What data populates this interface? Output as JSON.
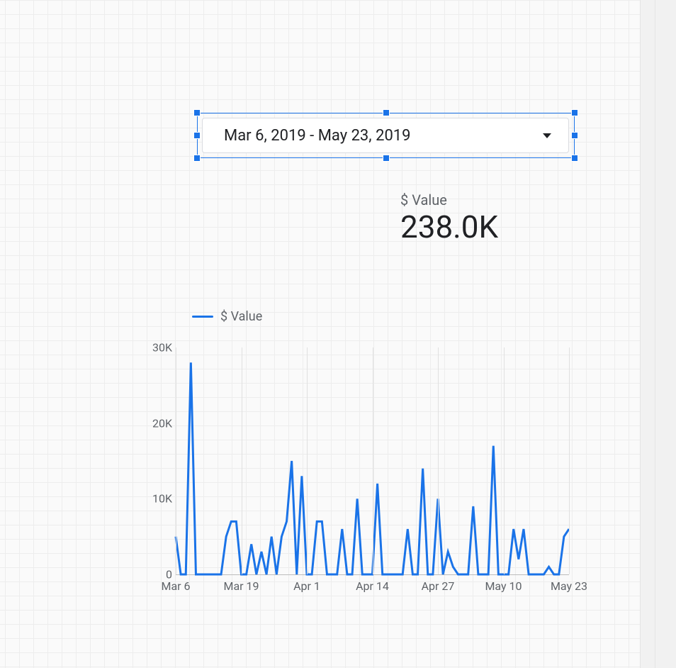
{
  "date_range": {
    "label": "Mar 6, 2019 - May 23, 2019"
  },
  "kpi": {
    "label": "$ Value",
    "value": "238.0K"
  },
  "legend": {
    "series_label": "$ Value"
  },
  "y_ticks": [
    "0",
    "10K",
    "20K",
    "30K"
  ],
  "x_ticks": [
    "Mar 6",
    "Mar 19",
    "Apr 1",
    "Apr 14",
    "Apr 27",
    "May 10",
    "May 23"
  ],
  "colors": {
    "series": "#1a73e8",
    "text_muted": "#5f6368",
    "text": "#202124"
  },
  "chart_data": {
    "type": "line",
    "title": "",
    "xlabel": "",
    "ylabel": "",
    "ylim": [
      0,
      30000
    ],
    "series": [
      {
        "name": "$ Value",
        "x": [
          "Mar 6",
          "Mar 7",
          "Mar 8",
          "Mar 9",
          "Mar 10",
          "Mar 11",
          "Mar 12",
          "Mar 13",
          "Mar 14",
          "Mar 15",
          "Mar 16",
          "Mar 17",
          "Mar 18",
          "Mar 19",
          "Mar 20",
          "Mar 21",
          "Mar 22",
          "Mar 23",
          "Mar 24",
          "Mar 25",
          "Mar 26",
          "Mar 27",
          "Mar 28",
          "Mar 29",
          "Mar 30",
          "Mar 31",
          "Apr 1",
          "Apr 2",
          "Apr 3",
          "Apr 4",
          "Apr 5",
          "Apr 6",
          "Apr 7",
          "Apr 8",
          "Apr 9",
          "Apr 10",
          "Apr 11",
          "Apr 12",
          "Apr 13",
          "Apr 14",
          "Apr 15",
          "Apr 16",
          "Apr 17",
          "Apr 18",
          "Apr 19",
          "Apr 20",
          "Apr 21",
          "Apr 22",
          "Apr 23",
          "Apr 24",
          "Apr 25",
          "Apr 26",
          "Apr 27",
          "Apr 28",
          "Apr 29",
          "Apr 30",
          "May 1",
          "May 2",
          "May 3",
          "May 4",
          "May 5",
          "May 6",
          "May 7",
          "May 8",
          "May 9",
          "May 10",
          "May 11",
          "May 12",
          "May 13",
          "May 14",
          "May 15",
          "May 16",
          "May 17",
          "May 18",
          "May 19",
          "May 20",
          "May 21",
          "May 22",
          "May 23"
        ],
        "values": [
          5000,
          0,
          0,
          28000,
          0,
          0,
          0,
          0,
          0,
          0,
          5000,
          7000,
          7000,
          0,
          0,
          4000,
          0,
          3000,
          0,
          5000,
          0,
          5000,
          7000,
          15000,
          0,
          13000,
          0,
          0,
          7000,
          7000,
          0,
          0,
          0,
          6000,
          0,
          0,
          10000,
          0,
          0,
          0,
          12000,
          0,
          0,
          0,
          0,
          0,
          6000,
          0,
          0,
          14000,
          0,
          0,
          10000,
          0,
          3000,
          1000,
          0,
          0,
          0,
          9000,
          0,
          0,
          0,
          17000,
          0,
          0,
          0,
          6000,
          2000,
          6000,
          0,
          0,
          0,
          0,
          1000,
          0,
          0,
          5000,
          6000
        ]
      }
    ]
  }
}
